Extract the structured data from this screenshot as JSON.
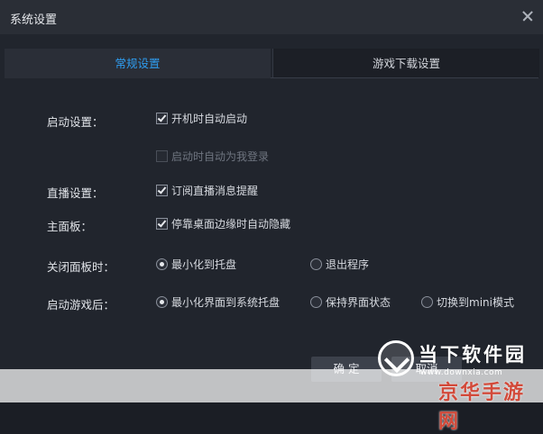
{
  "window": {
    "title": "系统设置"
  },
  "tabs": [
    {
      "label": "常规设置",
      "active": true
    },
    {
      "label": "游戏下载设置",
      "active": false
    }
  ],
  "settings": {
    "startup": {
      "label": "启动设置：",
      "options": [
        {
          "text": "开机时自动启动",
          "checked": true,
          "enabled": true
        },
        {
          "text": "启动时自动为我登录",
          "checked": false,
          "enabled": false
        }
      ]
    },
    "live": {
      "label": "直播设置：",
      "options": [
        {
          "text": "订阅直播消息提醒",
          "checked": true,
          "enabled": true
        }
      ]
    },
    "main_panel": {
      "label": "主面板：",
      "options": [
        {
          "text": "停靠桌面边缘时自动隐藏",
          "checked": true,
          "enabled": true
        }
      ]
    },
    "close_panel": {
      "label": "关闭面板时：",
      "options": [
        {
          "text": "最小化到托盘",
          "selected": true
        },
        {
          "text": "退出程序",
          "selected": false
        }
      ]
    },
    "after_launch": {
      "label": "启动游戏后：",
      "options": [
        {
          "text": "最小化界面到系统托盘",
          "selected": true
        },
        {
          "text": "保持界面状态",
          "selected": false
        },
        {
          "text": "切换到mini模式",
          "selected": false
        }
      ]
    }
  },
  "buttons": {
    "ok": "确 定",
    "cancel": "取消"
  },
  "watermark": {
    "site_cn": "当下软件园",
    "site_url": "www.downxia.com",
    "site_jh": "京华手游网"
  },
  "colors": {
    "accent": "#2f9df0",
    "background": "#21252d",
    "titlebar": "#2a2e36"
  }
}
